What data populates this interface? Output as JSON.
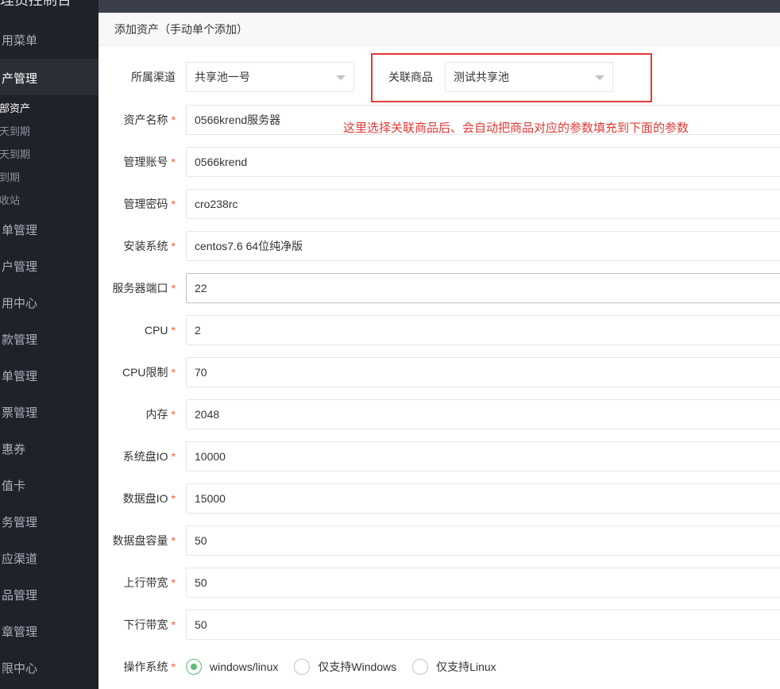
{
  "sidebar": {
    "title": "管理员控制台",
    "items": [
      {
        "label": "用菜单",
        "active": false
      },
      {
        "label": "产管理",
        "active": true
      },
      {
        "label": "单管理",
        "active": false
      },
      {
        "label": "户管理",
        "active": false
      },
      {
        "label": "用中心",
        "active": false
      },
      {
        "label": "款管理",
        "active": false
      },
      {
        "label": "单管理",
        "active": false
      },
      {
        "label": "票管理",
        "active": false
      },
      {
        "label": "惠券",
        "active": false
      },
      {
        "label": "值卡",
        "active": false
      },
      {
        "label": "务管理",
        "active": false
      },
      {
        "label": "应渠道",
        "active": false
      },
      {
        "label": "品管理",
        "active": false
      },
      {
        "label": "章管理",
        "active": false
      },
      {
        "label": "限中心",
        "active": false
      }
    ],
    "subitems": [
      {
        "label": "部资产",
        "active": true
      },
      {
        "label": "天到期",
        "active": false
      },
      {
        "label": "天到期",
        "active": false
      },
      {
        "label": "到期",
        "active": false
      },
      {
        "label": "收站",
        "active": false
      }
    ]
  },
  "dialog": {
    "title": "添加资产（手动单个添加）",
    "channel_label": "所属渠道",
    "channel_value": "共享池一号",
    "product_label": "关联商品",
    "product_value": "测试共享池",
    "annotation": "这里选择关联商品后、会自动把商品对应的参数填充到下面的参数",
    "fields": [
      {
        "label": "资产名称",
        "value": "0566krend服务器"
      },
      {
        "label": "管理账号",
        "value": "0566krend"
      },
      {
        "label": "管理密码",
        "value": "cro238rc"
      },
      {
        "label": "安装系统",
        "value": "centos7.6 64位纯净版"
      },
      {
        "label": "服务器端口",
        "value": "22"
      },
      {
        "label": "CPU",
        "value": "2"
      },
      {
        "label": "CPU限制",
        "value": "70"
      },
      {
        "label": "内存",
        "value": "2048"
      },
      {
        "label": "系统盘IO",
        "value": "10000"
      },
      {
        "label": "数据盘IO",
        "value": "15000"
      },
      {
        "label": "数据盘容量",
        "value": "50"
      },
      {
        "label": "上行带宽",
        "value": "50"
      },
      {
        "label": "下行带宽",
        "value": "50"
      }
    ],
    "required_mark": "*",
    "os_label": "操作系统",
    "os_options": [
      {
        "label": "windows/linux",
        "checked": true
      },
      {
        "label": "仅支持Windows",
        "checked": false
      },
      {
        "label": "仅支持Linux",
        "checked": false
      }
    ],
    "colors": {
      "required": "#ff5722",
      "annotation": "#e53935",
      "radio_checked": "#5fb878"
    }
  }
}
